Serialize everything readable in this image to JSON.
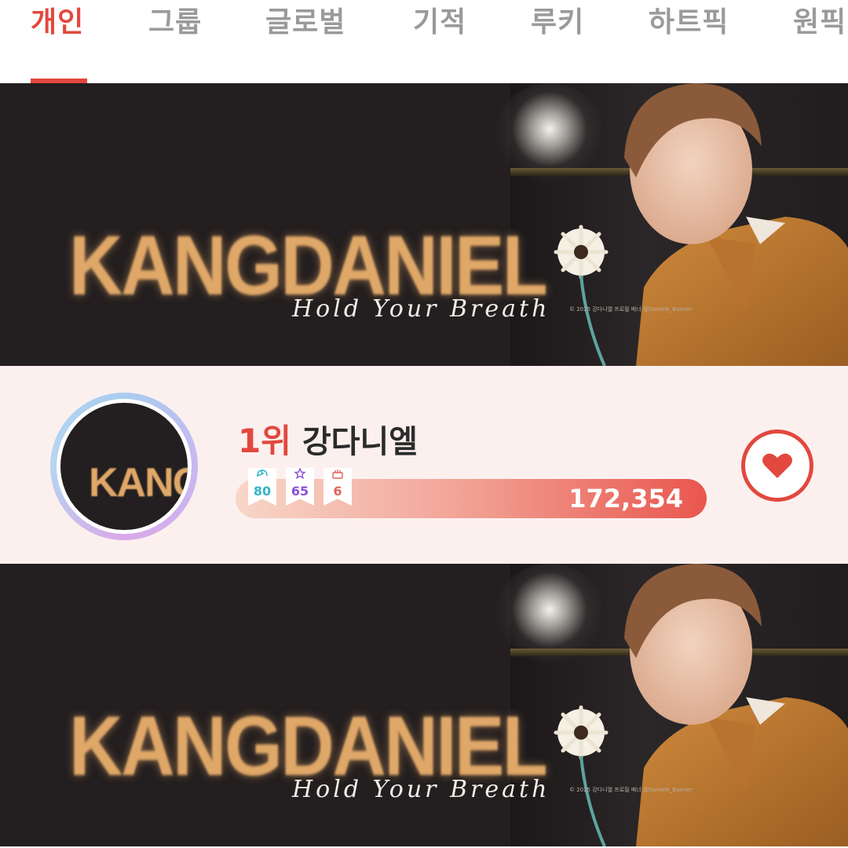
{
  "tabs": [
    {
      "label": "개인",
      "active": true
    },
    {
      "label": "그룹"
    },
    {
      "label": "글로벌"
    },
    {
      "label": "기적"
    },
    {
      "label": "루키"
    },
    {
      "label": "하트픽"
    },
    {
      "label": "원픽"
    }
  ],
  "banner": {
    "title": "KANGDANIEL",
    "script": "Hold Your Breath",
    "credit": "© 2025 강다니엘 프로필 배너 @DanielK_Banner"
  },
  "ranking": {
    "rank": "1위",
    "name": "강다니엘",
    "avatar_text": "KANG",
    "badges": [
      {
        "icon": "angel-wing-icon",
        "value": "80"
      },
      {
        "icon": "star-icon",
        "value": "65"
      },
      {
        "icon": "cake-icon",
        "value": "6"
      }
    ],
    "votes": "172,354"
  },
  "colors": {
    "accent": "#e2483e",
    "banner_bg": "#231e1f",
    "title_gold": "#e0a868",
    "row_bg": "#fcf0ef"
  }
}
